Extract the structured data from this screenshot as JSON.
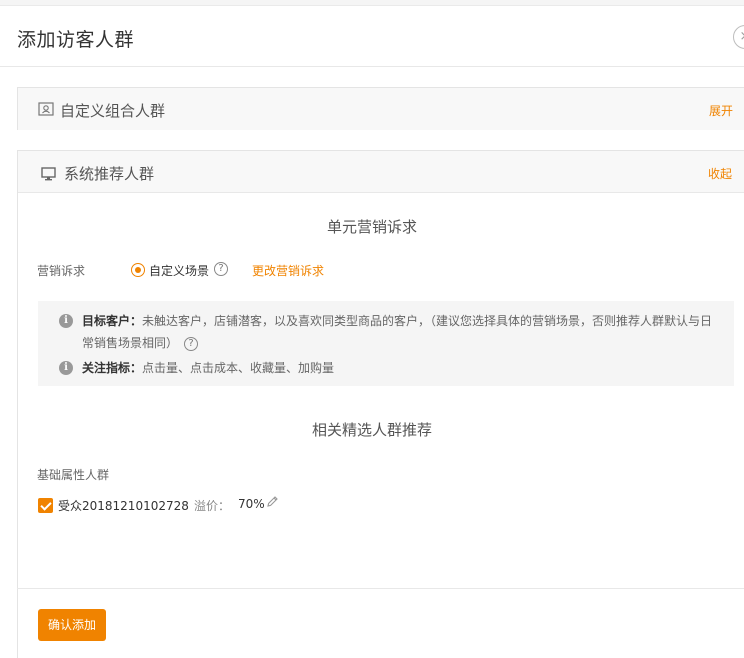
{
  "dialog": {
    "title": "添加访客人群",
    "close_symbol": "×"
  },
  "panels": {
    "custom": {
      "title": "自定义组合人群",
      "toggle": "展开",
      "icon": "custom-group-icon"
    },
    "system": {
      "title": "系统推荐人群",
      "toggle": "收起",
      "icon": "monitor-icon"
    }
  },
  "marketing": {
    "section_title": "单元营销诉求",
    "label": "营销诉求",
    "selected_option": "自定义场景",
    "change_link": "更改营销诉求",
    "info": {
      "target_label": "目标客户：",
      "target_text": "未触达客户，店铺潜客，以及喜欢同类型商品的客户，（建议您选择具体的营销场景，否则推荐人群默认与日常销售场景相同）",
      "focus_label": "关注指标：",
      "focus_text": "点击量、点击成本、收藏量、加购量"
    }
  },
  "recommend": {
    "section_title": "相关精选人群推荐",
    "basic_label": "基础属性人群",
    "audience": {
      "name": "受众20181210102728",
      "premium_label": "溢价：",
      "premium_value": "70%",
      "checked": true
    }
  },
  "footer": {
    "confirm_label": "确认添加"
  },
  "colors": {
    "accent": "#f08300"
  }
}
